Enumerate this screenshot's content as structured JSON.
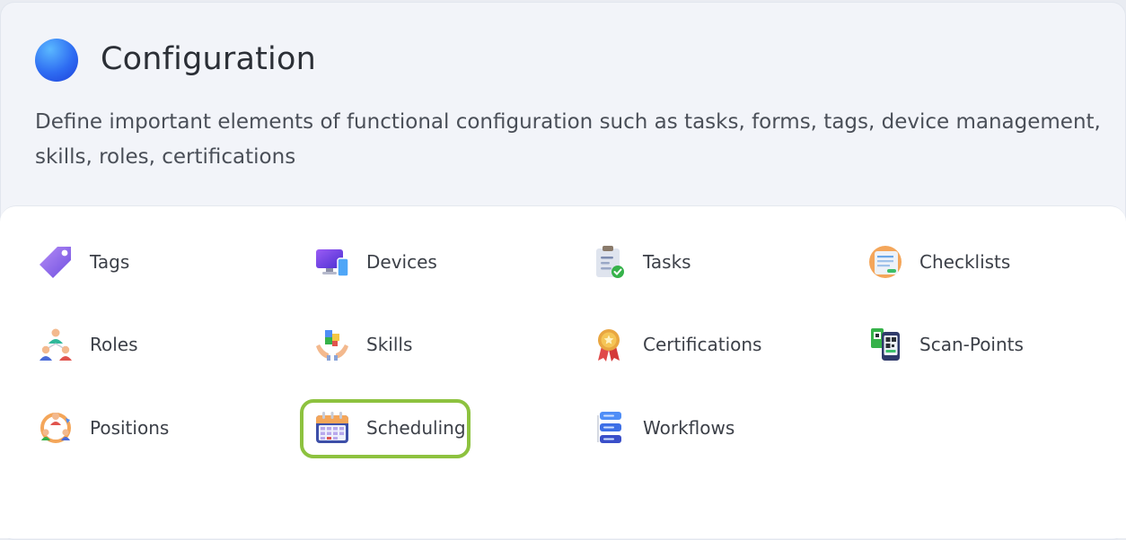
{
  "header": {
    "title": "Configuration",
    "description": "Define important elements of functional configuration such as tasks, forms, tags, device management, skills, roles, certifications"
  },
  "items": [
    {
      "label": "Tags",
      "icon": "tag-icon"
    },
    {
      "label": "Devices",
      "icon": "devices-icon"
    },
    {
      "label": "Tasks",
      "icon": "clipboard-check-icon"
    },
    {
      "label": "Checklists",
      "icon": "checklist-icon"
    },
    {
      "label": "Roles",
      "icon": "team-roles-icon"
    },
    {
      "label": "Skills",
      "icon": "puzzle-hands-icon"
    },
    {
      "label": "Certifications",
      "icon": "award-medal-icon"
    },
    {
      "label": "Scan-Points",
      "icon": "qr-phone-icon"
    },
    {
      "label": "Positions",
      "icon": "people-cycle-icon"
    },
    {
      "label": "Scheduling",
      "icon": "calendar-icon"
    },
    {
      "label": "Workflows",
      "icon": "workflow-blocks-icon"
    }
  ],
  "selected_item": "Scheduling",
  "colors": {
    "highlight": "#8dc23f",
    "accent": "#2e6cf2"
  }
}
